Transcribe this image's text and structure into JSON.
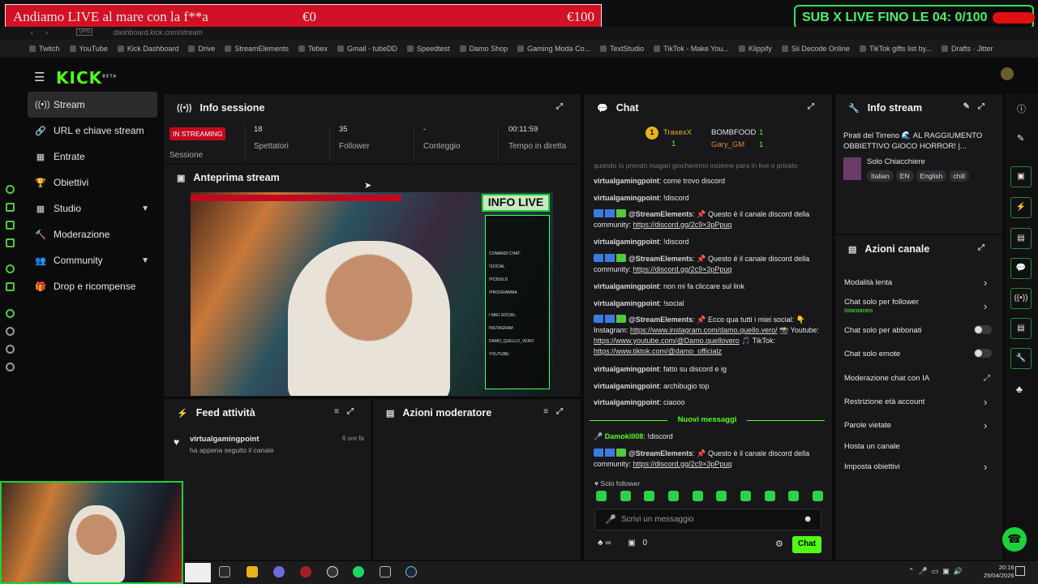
{
  "overlay": {
    "goal_text": "Andiamo LIVE al mare con la f**a",
    "goal_current": "€0",
    "goal_target": "€100",
    "sub_goal": "SUB X LIVE FINO LE 04: 0/100"
  },
  "browser": {
    "url": "dashboard.kick.com/stream",
    "vpn": "VPN",
    "bookmarks": [
      "Twitch",
      "YouTube",
      "Kick Dashboard",
      "Drive",
      "StreamElements",
      "Tebex",
      "Gmail - tubeDD",
      "Speedtest",
      "Damo Shop",
      "Gaming Moda Co...",
      "TextStudio",
      "TikTok - Make You...",
      "Klippify",
      "Sii Decode Online",
      "TikTok gifts list by...",
      "Drafts · Jitter"
    ]
  },
  "sidebar": {
    "items": [
      {
        "label": "Stream",
        "icon": "broadcast-icon"
      },
      {
        "label": "URL e chiave stream",
        "icon": "link-icon"
      },
      {
        "label": "Entrate",
        "icon": "money-icon"
      },
      {
        "label": "Obiettivi",
        "icon": "trophy-icon"
      },
      {
        "label": "Studio",
        "icon": "grid-icon"
      },
      {
        "label": "Moderazione",
        "icon": "hammer-icon"
      },
      {
        "label": "Community",
        "icon": "community-icon"
      },
      {
        "label": "Drop e ricompense",
        "icon": "gift-icon"
      }
    ]
  },
  "info_sessione": {
    "title": "Info sessione",
    "live_badge": "IN STREAMING",
    "session_label": "Sessione",
    "spectators": "18",
    "spectators_label": "Spettatori",
    "followers": "35",
    "followers_label": "Follower",
    "countdown": "-",
    "countdown_label": "Conteggio",
    "time": "00:11:59",
    "time_label": "Tempo in diretta"
  },
  "preview": {
    "title": "Anteprima stream",
    "info_live": "INFO LIVE",
    "side_lines": [
      "COMANDI CHAT:",
      "!SOCIAL",
      "!PCBUILD",
      "!PROGRAMMA",
      "I MIEI SOCIAL:",
      "INSTAGRAM:",
      "DAMO_QUELLO_VERO",
      "YOUTUBE:"
    ]
  },
  "feed": {
    "title": "Feed attività",
    "user": "virtualgamingpoint",
    "text": "ha appena seguito il canale",
    "time": "6 ore fa"
  },
  "mod": {
    "title": "Azioni moderatore"
  },
  "chat": {
    "title": "Chat",
    "pinned": [
      {
        "rank": "1",
        "name": "TraxexX",
        "gift": "1"
      },
      {
        "name": "BOMBFOOD",
        "gift": "1"
      },
      {
        "name": "Gary_GM",
        "gift": "1"
      }
    ],
    "partial_line": "quando lo prendo magari giocheremo insieme para in live o privato",
    "messages": [
      {
        "user": "virtualgamingpoint",
        "text": "come trovo discord"
      },
      {
        "user": "virtualgamingpoint",
        "text": "!discord"
      },
      {
        "user": "@StreamElements",
        "text": "📌 Questo è il canale discord della community:",
        "link": "https://discord.gg/2c9×3pPpuq"
      },
      {
        "user": "virtualgamingpoint",
        "text": "!discord"
      },
      {
        "user": "@StreamElements",
        "text": "📌 Questo è il canale discord della community:",
        "link": "https://discord.gg/2c9×3pPpuq"
      },
      {
        "user": "virtualgamingpoint",
        "text": "non mi fa cliccare sul link"
      },
      {
        "user": "virtualgamingpoint",
        "text": "!social"
      },
      {
        "user": "@StreamElements",
        "text": "📌 Ecco qua tutti i miei social: 👇 Instagram:",
        "link": "https://www.instagram.com/damo.quello.vero/",
        "text2": "📸 Youtube:",
        "link2": "https://www.youtube.com/@Damo.quellovero",
        "text3": "🎵 TikTok:",
        "link3": "https://www.tiktok.com/@damo_officialz"
      },
      {
        "user": "virtualgamingpoint",
        "text": "fatto su discord e ig"
      },
      {
        "user": "virtualgamingpoint",
        "text": "archibugio top"
      },
      {
        "user": "virtualgamingpoint",
        "text": "ciaooo"
      }
    ],
    "new_messages": "Nuovi messaggi",
    "after_messages": [
      {
        "user": "Damokill08",
        "text": "!discord"
      },
      {
        "user": "@StreamElements",
        "text": "📌 Questo è il canale discord della community:",
        "link": "https://discord.gg/2c9×3pPpuq"
      }
    ],
    "follower_only": "Solo follower",
    "input_placeholder": "Scrivi un messaggio",
    "infinity": "∞",
    "count": "0",
    "send_label": "Chat"
  },
  "info_stream": {
    "title": "Info stream",
    "stream_title": "Pirati del Tirreno 🌊 AL RAGGIUMENTO OBBIETTIVO GIOCO HORROR! |...",
    "category": "Solo Chiacchiere",
    "tags": [
      "Italian",
      "EN",
      "English",
      "chill"
    ]
  },
  "azioni_canale": {
    "title": "Azioni canale",
    "items": [
      {
        "label": "Modalità lenta",
        "type": "chevron"
      },
      {
        "label": "Chat solo per follower",
        "sub": "Istantaneo",
        "type": "chevron"
      },
      {
        "label": "Chat solo per abbonati",
        "type": "toggle"
      },
      {
        "label": "Chat solo emote",
        "type": "toggle"
      },
      {
        "label": "Moderazione chat con IA",
        "type": "external"
      },
      {
        "label": "Restrizione età account",
        "type": "chevron"
      },
      {
        "label": "Parole vietate",
        "type": "chevron"
      },
      {
        "label": "Hosta un canale",
        "type": "none"
      },
      {
        "label": "Imposta obiettivi",
        "type": "chevron"
      }
    ]
  },
  "taskbar": {
    "time": "20:16",
    "date": "25/04/2026"
  },
  "colors": {
    "accent": "#53fc18",
    "live": "#c3091f",
    "panel": "#18181b"
  }
}
